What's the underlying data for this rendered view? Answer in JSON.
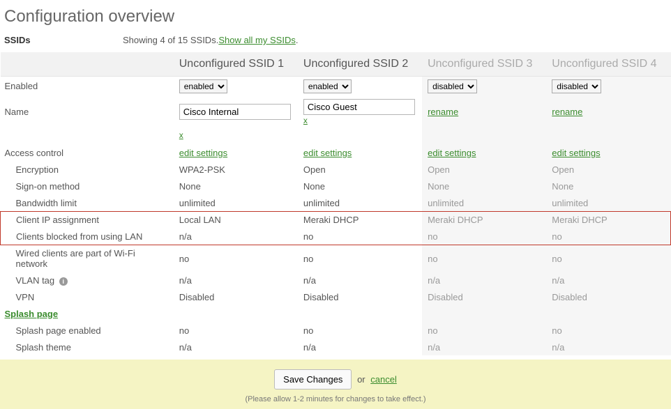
{
  "page_title": "Configuration overview",
  "ssids_header": {
    "label": "SSIDs",
    "showing_text": "Showing 4 of 15 SSIDs. ",
    "show_all_link": "Show all my SSIDs"
  },
  "columns": [
    {
      "header": "Unconfigured SSID 1",
      "disabled": false
    },
    {
      "header": "Unconfigured SSID 2",
      "disabled": false
    },
    {
      "header": "Unconfigured SSID 3",
      "disabled": true
    },
    {
      "header": "Unconfigured SSID 4",
      "disabled": true
    }
  ],
  "rows": {
    "enabled": {
      "label": "Enabled",
      "values": [
        "enabled",
        "enabled",
        "disabled",
        "disabled"
      ]
    },
    "name": {
      "label": "Name",
      "values": [
        "Cisco Internal",
        "Cisco Guest",
        "rename",
        "rename"
      ],
      "x": [
        "x",
        "x",
        "",
        ""
      ]
    },
    "access_control": {
      "label": "Access control",
      "link": "edit settings"
    },
    "encryption": {
      "label": "Encryption",
      "values": [
        "WPA2-PSK",
        "Open",
        "Open",
        "Open"
      ]
    },
    "signon": {
      "label": "Sign-on method",
      "values": [
        "None",
        "None",
        "None",
        "None"
      ]
    },
    "bandwidth": {
      "label": "Bandwidth limit",
      "values": [
        "unlimited",
        "unlimited",
        "unlimited",
        "unlimited"
      ]
    },
    "clientip": {
      "label": "Client IP assignment",
      "values": [
        "Local LAN",
        "Meraki DHCP",
        "Meraki DHCP",
        "Meraki DHCP"
      ]
    },
    "blocked": {
      "label": "Clients blocked from using LAN",
      "values": [
        "n/a",
        "no",
        "no",
        "no"
      ]
    },
    "wired": {
      "label": "Wired clients are part of Wi-Fi network",
      "values": [
        "no",
        "no",
        "no",
        "no"
      ]
    },
    "vlan": {
      "label": "VLAN tag",
      "values": [
        "n/a",
        "n/a",
        "n/a",
        "n/a"
      ]
    },
    "vpn": {
      "label": "VPN",
      "values": [
        "Disabled",
        "Disabled",
        "Disabled",
        "Disabled"
      ]
    },
    "splash": {
      "label": "Splash page"
    },
    "splash_enabled": {
      "label": "Splash page enabled",
      "values": [
        "no",
        "no",
        "no",
        "no"
      ]
    },
    "splash_theme": {
      "label": "Splash theme",
      "values": [
        "n/a",
        "n/a",
        "n/a",
        "n/a"
      ]
    }
  },
  "footer": {
    "save": "Save Changes",
    "or": "or",
    "cancel": "cancel",
    "note": "(Please allow 1-2 minutes for changes to take effect.)"
  }
}
